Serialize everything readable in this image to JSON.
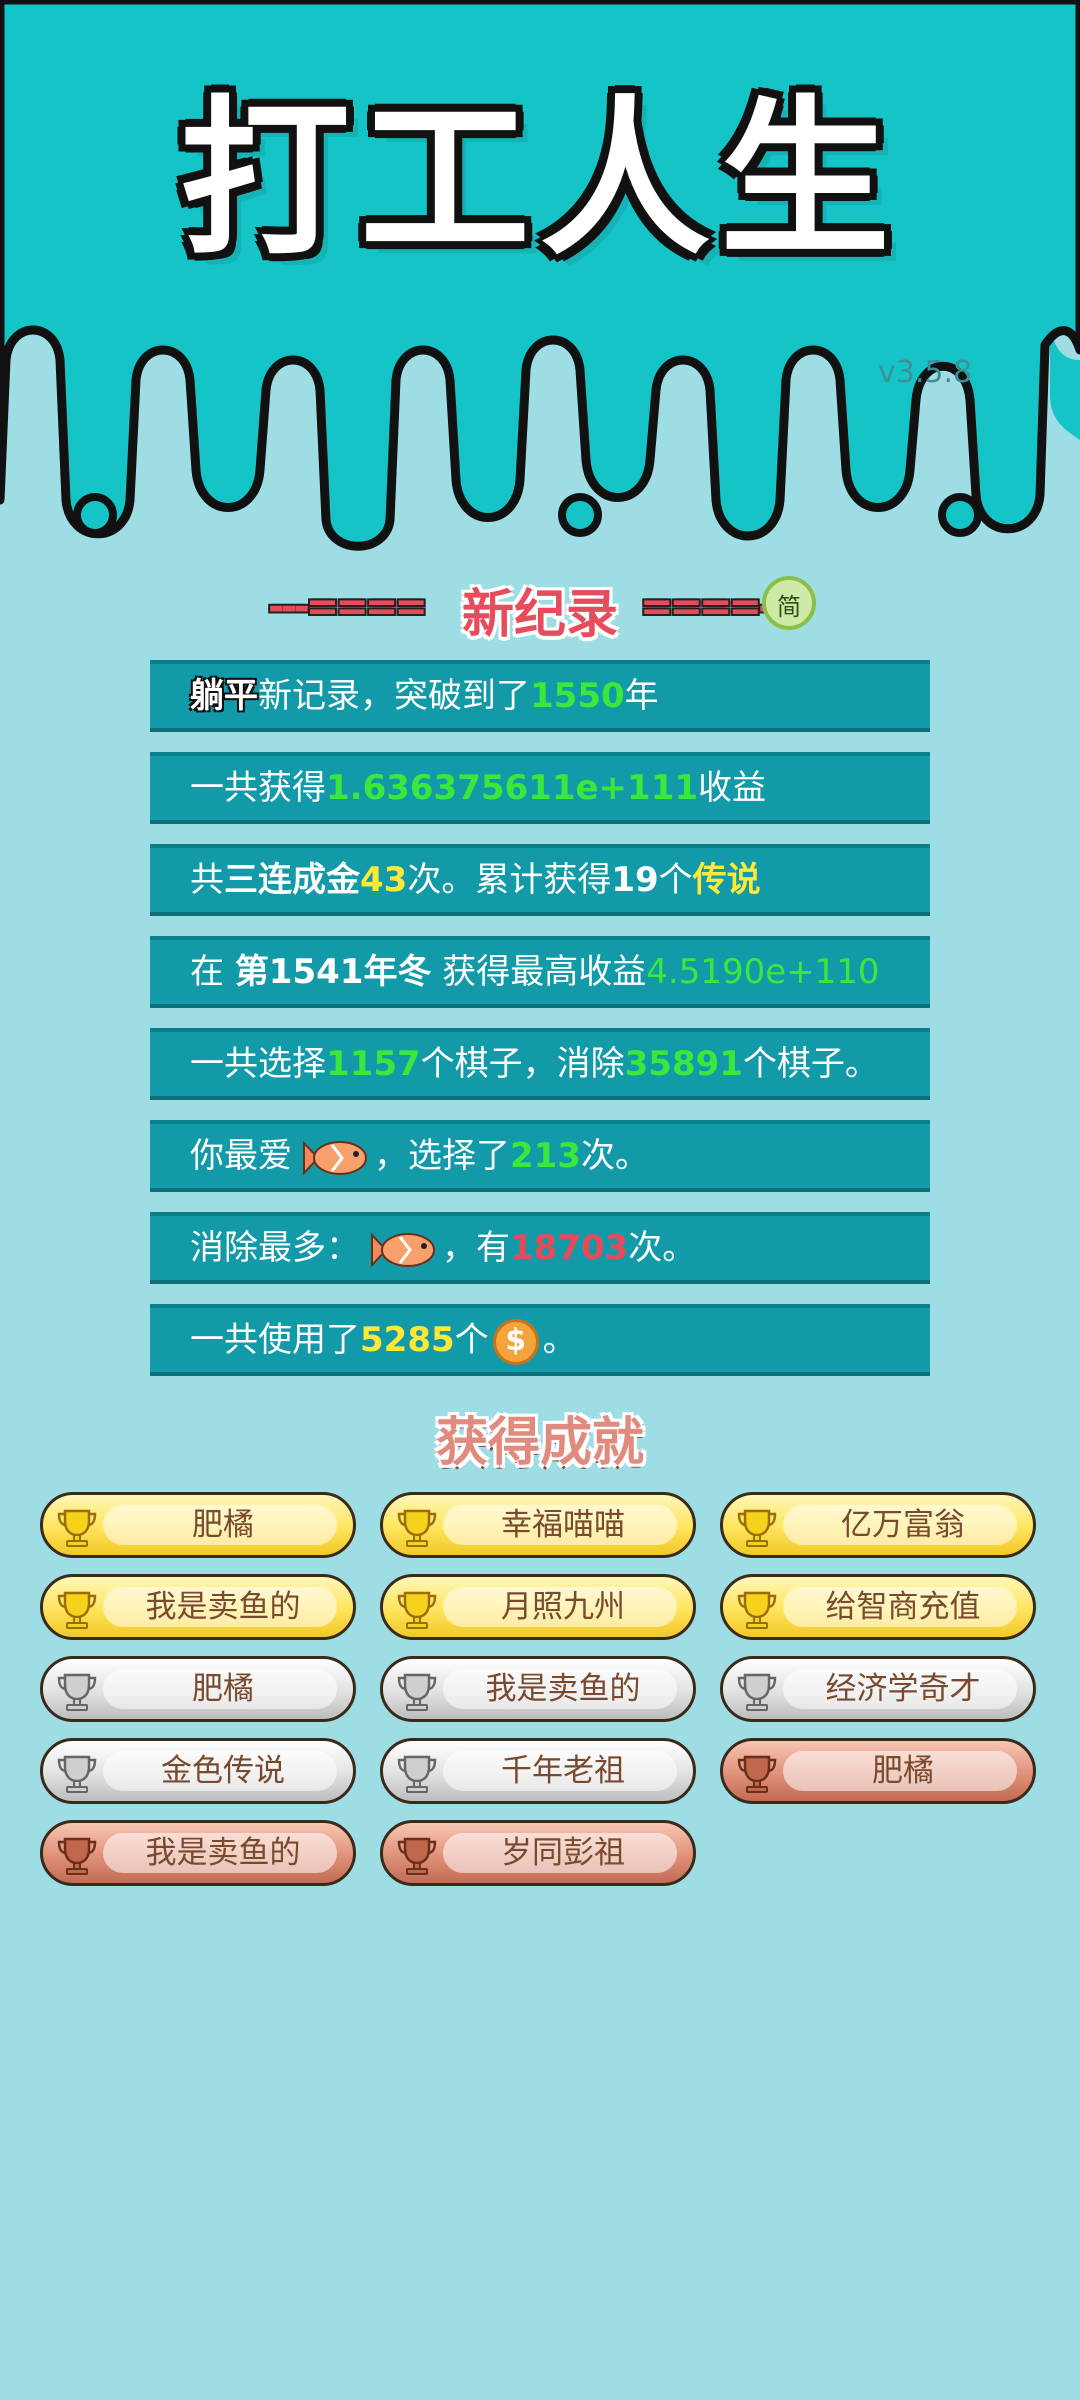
{
  "app": {
    "title": "打工人生",
    "version": "v3.5.8"
  },
  "record": {
    "header": "新纪录",
    "left_dashes": "---====",
    "right_dashes": "====-",
    "simplified_badge": "简"
  },
  "stats": {
    "r1": {
      "a": "躺平",
      "b": "新记录，突破到了",
      "c": "1550",
      "d": "年"
    },
    "r2": {
      "a": "一共获得",
      "b": "1.636375611e+111",
      "c": "收益"
    },
    "r3": {
      "a": "共",
      "b": "三连成金",
      "c": "43",
      "d": "次。累计获得",
      "e": "19",
      "f": "个",
      "g": "传说"
    },
    "r4": {
      "a": "在 ",
      "b": "第1541年冬",
      "c": " 获得最高收益",
      "d": "4.5190e+110"
    },
    "r5": {
      "a": "一共选择",
      "b": "1157",
      "c": "个棋子，消除",
      "d": "35891",
      "e": "个棋子。"
    },
    "r6": {
      "a": "你最爱",
      "b": "，选择了",
      "c": "213",
      "d": "次。"
    },
    "r7": {
      "a": "消除最多：",
      "b": "，有",
      "c": "18703",
      "d": "次。"
    },
    "r8": {
      "a": "一共使用了",
      "b": "5285",
      "c": "个",
      "d": "。",
      "coin_symbol": "$"
    }
  },
  "achievements": {
    "title": "获得成就",
    "items": [
      {
        "label": "肥橘",
        "tier": "gold"
      },
      {
        "label": "幸福喵喵",
        "tier": "gold"
      },
      {
        "label": "亿万富翁",
        "tier": "gold"
      },
      {
        "label": "我是卖鱼的",
        "tier": "gold"
      },
      {
        "label": "月照九州",
        "tier": "gold"
      },
      {
        "label": "给智商充值",
        "tier": "gold"
      },
      {
        "label": "肥橘",
        "tier": "silver"
      },
      {
        "label": "我是卖鱼的",
        "tier": "silver"
      },
      {
        "label": "经济学奇才",
        "tier": "silver"
      },
      {
        "label": "金色传说",
        "tier": "silver"
      },
      {
        "label": "千年老祖",
        "tier": "silver"
      },
      {
        "label": "肥橘",
        "tier": "bronze"
      },
      {
        "label": "我是卖鱼的",
        "tier": "bronze"
      },
      {
        "label": "岁同彭祖",
        "tier": "bronze"
      }
    ]
  },
  "colors": {
    "top_band": "#15c4c7",
    "background": "#9fdde5",
    "row_bg": "#139aa8",
    "highlight_green": "#39e83a",
    "highlight_yellow": "#ffe836",
    "highlight_red": "#e84a5a"
  }
}
